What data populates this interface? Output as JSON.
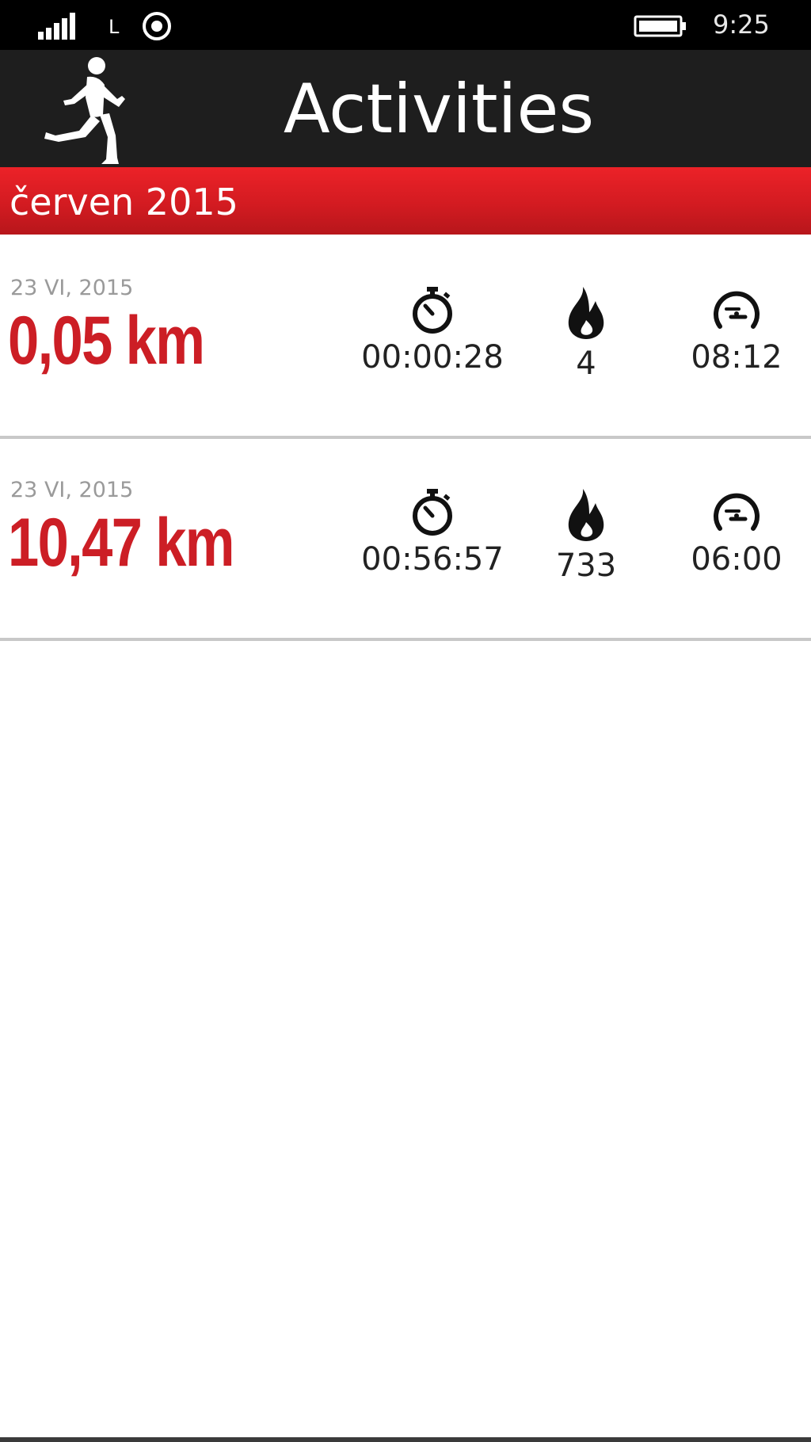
{
  "status_bar": {
    "network": "L",
    "time": "9:25",
    "icons": [
      "signal-icon",
      "location-icon",
      "battery-icon"
    ]
  },
  "header": {
    "title": "Activities",
    "icon": "runner-icon"
  },
  "month": {
    "label": "červen 2015"
  },
  "activities": [
    {
      "date": "23 VI, 2015",
      "distance": "0,05 km",
      "duration": "00:00:28",
      "calories": "4",
      "pace": "08:12"
    },
    {
      "date": "23 VI, 2015",
      "distance": "10,47 km",
      "duration": "00:56:57",
      "calories": "733",
      "pace": "06:00"
    }
  ],
  "colors": {
    "accent": "#cc1e25",
    "header_bg": "#1e1e1e",
    "status_bg": "#000000",
    "band_red": "#d31b21"
  }
}
